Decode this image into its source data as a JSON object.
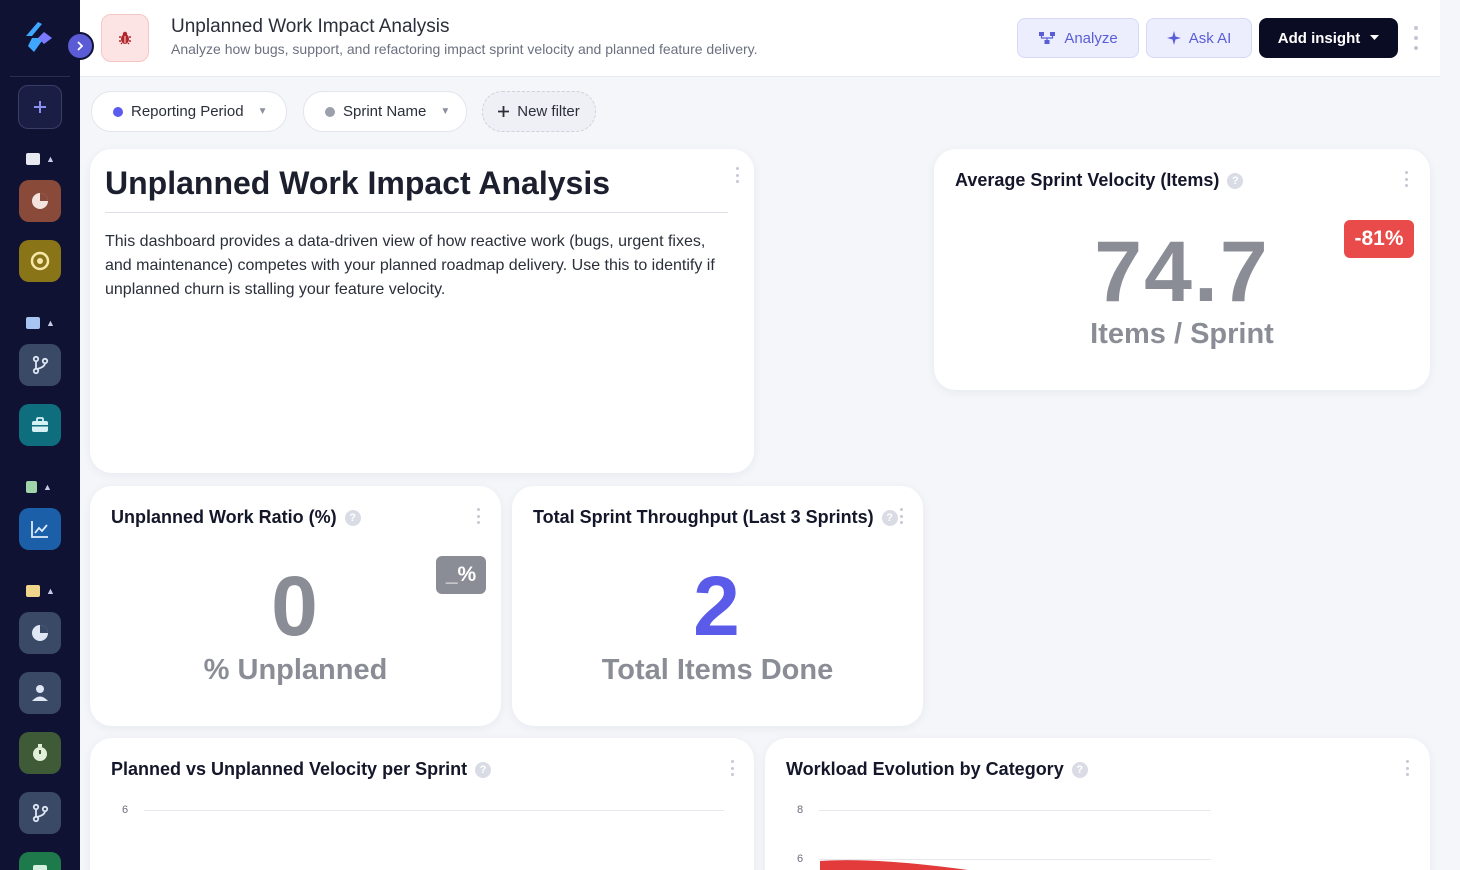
{
  "header": {
    "title": "Unplanned Work Impact Analysis",
    "subtitle": "Analyze how bugs, support, and refactoring impact sprint velocity and planned feature delivery.",
    "analyze_label": "Analyze",
    "ask_ai_label": "Ask AI",
    "add_insight_label": "Add insight"
  },
  "filters": [
    {
      "label": "Reporting Period",
      "dot_color": "#5b5bf0"
    },
    {
      "label": "Sprint Name",
      "dot_color": "#9ca0ad"
    }
  ],
  "new_filter_label": "New filter",
  "intro": {
    "title": "Unplanned Work Impact Analysis",
    "text": "This dashboard provides a data-driven view of how reactive work (bugs, urgent fixes, and maintenance) competes with your planned roadmap delivery. Use this to identify if unplanned churn is stalling your feature velocity."
  },
  "velocity_card": {
    "title": "Average Sprint Velocity (Items)",
    "value": "74.7",
    "unit": "Items / Sprint",
    "badge": "-81%",
    "badge_color": "#e94a4a"
  },
  "ratio_card": {
    "title": "Unplanned Work Ratio (%)",
    "value": "0",
    "unit": "% Unplanned",
    "badge": "_%",
    "badge_color": "#8a8d95"
  },
  "throughput_card": {
    "title": "Total Sprint Throughput (Last 3 Sprints)",
    "value": "2",
    "unit": "Total Items Done",
    "value_color": "#5b5bea"
  },
  "velocity_chart": {
    "title": "Planned vs Unplanned Velocity per Sprint",
    "ticks": [
      "6"
    ]
  },
  "workload_chart": {
    "title": "Workload Evolution by Category",
    "ticks": [
      "8",
      "6"
    ]
  },
  "colors": {
    "sidebar": "#0f1233",
    "accent": "#5b5bd6",
    "series_red": "#e33b3b"
  }
}
